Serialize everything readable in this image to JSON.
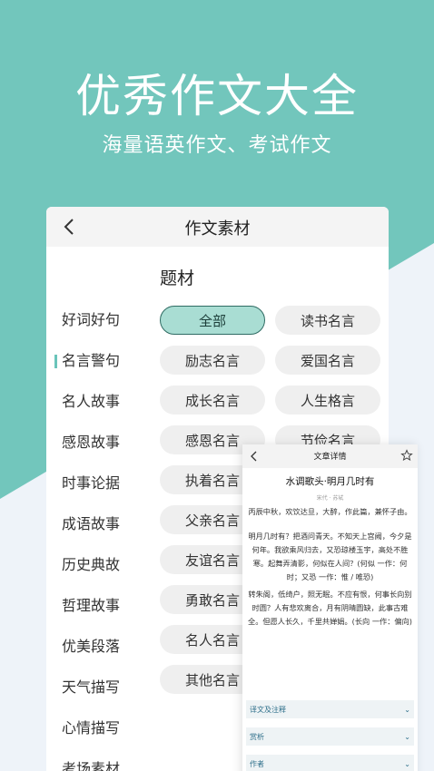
{
  "hero": {
    "title": "优秀作文大全",
    "subtitle": "海量语英作文、考试作文"
  },
  "colors": {
    "teal": "#72c6bc",
    "light_bg": "#eef3f9",
    "active_chip_bg": "#a9ddd3",
    "active_chip_border": "#2f6b63"
  },
  "card": {
    "back_icon": "chevron-left-icon",
    "title": "作文素材",
    "section_title": "题材",
    "sidebar": [
      {
        "label": "好词好句"
      },
      {
        "label": "名言警句"
      },
      {
        "label": "名人故事"
      },
      {
        "label": "感恩故事"
      },
      {
        "label": "时事论据"
      },
      {
        "label": "成语故事"
      },
      {
        "label": "历史典故"
      },
      {
        "label": "哲理故事"
      },
      {
        "label": "优美段落"
      },
      {
        "label": "天气描写"
      },
      {
        "label": "心情描写"
      },
      {
        "label": "考场素材"
      }
    ],
    "active_sidebar": "名言警句",
    "chips": [
      {
        "label": "全部"
      },
      {
        "label": "读书名言"
      },
      {
        "label": "励志名言"
      },
      {
        "label": "爱国名言"
      },
      {
        "label": "成长名言"
      },
      {
        "label": "人生格言"
      },
      {
        "label": "感恩名言"
      },
      {
        "label": "节俭名言"
      },
      {
        "label": "执着名言"
      },
      {
        "label": ""
      },
      {
        "label": "父亲名言"
      },
      {
        "label": ""
      },
      {
        "label": "友谊名言"
      },
      {
        "label": ""
      },
      {
        "label": "勇敢名言"
      },
      {
        "label": ""
      },
      {
        "label": "名人名言"
      },
      {
        "label": ""
      },
      {
        "label": "其他名言"
      },
      {
        "label": ""
      }
    ],
    "active_chip": "全部"
  },
  "popup": {
    "back_icon": "chevron-left-icon",
    "title": "文章详情",
    "star_icon": "star-outline-icon",
    "poem_title": "水调歌头·明月几时有",
    "poem_author": "宋代 · 苏轼",
    "preface": "丙辰中秋，欢饮达旦，大醉，作此篇，兼怀子由。",
    "stanza1": "明月几时有？把酒问青天。不知天上宫阙，今夕是何年。我欲乘风归去，又恐琼楼玉宇，高处不胜寒。起舞弄清影，何似在人间？(何似 一作：何时；又恐 一作：惟 / 唯恐)",
    "stanza2": "转朱阁，低绮户，照无眠。不应有恨，何事长向别时圆？人有悲欢离合，月有阴晴圆缺，此事古难全。但愿人长久，千里共婵娟。(长向 一作：偏向)",
    "sections": [
      {
        "label": "译文及注释"
      },
      {
        "label": "赏析"
      },
      {
        "label": "作者"
      }
    ]
  }
}
